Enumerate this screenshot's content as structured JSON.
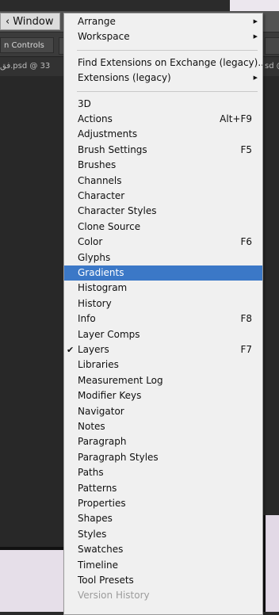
{
  "menubar": {
    "window_label": "Window",
    "prefix_char": "‹"
  },
  "options_bar": {
    "controls_label": "n Controls"
  },
  "doc_tabs": {
    "left_tab": "فق.psd @ 33",
    "right_tab": "sd @"
  },
  "menu": {
    "top_items": [
      {
        "label": "Arrange",
        "submenu": true
      },
      {
        "label": "Workspace",
        "submenu": true
      }
    ],
    "ext_items": [
      {
        "label": "Find Extensions on Exchange (legacy)...",
        "submenu": false
      },
      {
        "label": "Extensions (legacy)",
        "submenu": true
      }
    ],
    "panel_items": [
      {
        "label": "3D",
        "shortcut": ""
      },
      {
        "label": "Actions",
        "shortcut": "Alt+F9"
      },
      {
        "label": "Adjustments",
        "shortcut": ""
      },
      {
        "label": "Brush Settings",
        "shortcut": "F5"
      },
      {
        "label": "Brushes",
        "shortcut": ""
      },
      {
        "label": "Channels",
        "shortcut": ""
      },
      {
        "label": "Character",
        "shortcut": ""
      },
      {
        "label": "Character Styles",
        "shortcut": ""
      },
      {
        "label": "Clone Source",
        "shortcut": ""
      },
      {
        "label": "Color",
        "shortcut": "F6"
      },
      {
        "label": "Glyphs",
        "shortcut": ""
      },
      {
        "label": "Gradients",
        "shortcut": "",
        "selected": true
      },
      {
        "label": "Histogram",
        "shortcut": ""
      },
      {
        "label": "History",
        "shortcut": ""
      },
      {
        "label": "Info",
        "shortcut": "F8"
      },
      {
        "label": "Layer Comps",
        "shortcut": ""
      },
      {
        "label": "Layers",
        "shortcut": "F7",
        "checked": true
      },
      {
        "label": "Libraries",
        "shortcut": ""
      },
      {
        "label": "Measurement Log",
        "shortcut": ""
      },
      {
        "label": "Modifier Keys",
        "shortcut": ""
      },
      {
        "label": "Navigator",
        "shortcut": ""
      },
      {
        "label": "Notes",
        "shortcut": ""
      },
      {
        "label": "Paragraph",
        "shortcut": ""
      },
      {
        "label": "Paragraph Styles",
        "shortcut": ""
      },
      {
        "label": "Paths",
        "shortcut": ""
      },
      {
        "label": "Patterns",
        "shortcut": ""
      },
      {
        "label": "Properties",
        "shortcut": ""
      },
      {
        "label": "Shapes",
        "shortcut": ""
      },
      {
        "label": "Styles",
        "shortcut": ""
      },
      {
        "label": "Swatches",
        "shortcut": ""
      },
      {
        "label": "Timeline",
        "shortcut": ""
      },
      {
        "label": "Tool Presets",
        "shortcut": ""
      },
      {
        "label": "Version History",
        "shortcut": "",
        "disabled": true
      }
    ],
    "submenu_arrow": "▶",
    "check_mark": "✔",
    "highlight_color": "#3b78c7"
  }
}
